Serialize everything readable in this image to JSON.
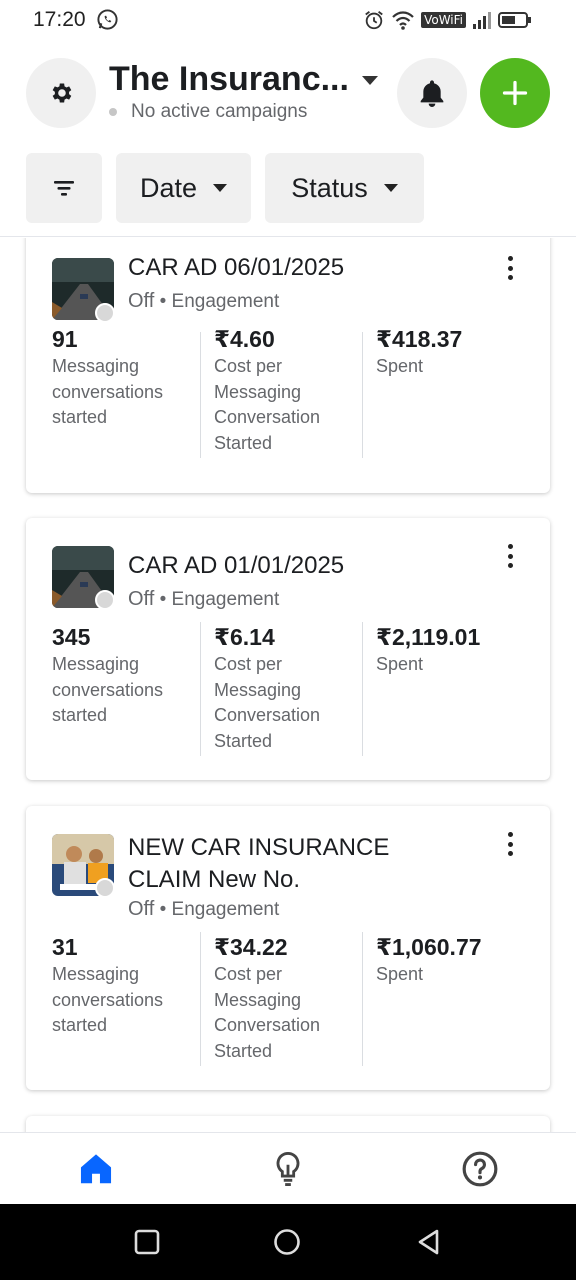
{
  "status_bar": {
    "time": "17:20",
    "vowifi_label": "VoWiFi"
  },
  "header": {
    "account_name": "The Insuranc...",
    "campaign_status": "No active campaigns"
  },
  "filters": {
    "date_label": "Date",
    "status_label": "Status"
  },
  "campaigns": [
    {
      "name": "CAR AD 06/01/2025",
      "state": "Off",
      "objective": "Engagement",
      "metrics": [
        {
          "value": "91",
          "label": "Messaging conversations started"
        },
        {
          "value": "₹4.60",
          "label": "Cost per Messaging Conversation Started"
        },
        {
          "value": "₹418.37",
          "label": "Spent"
        }
      ]
    },
    {
      "name": "CAR AD 01/01/2025",
      "state": "Off",
      "objective": "Engagement",
      "metrics": [
        {
          "value": "345",
          "label": "Messaging conversations started"
        },
        {
          "value": "₹6.14",
          "label": "Cost per Messaging Conversation Started"
        },
        {
          "value": "₹2,119.01",
          "label": "Spent"
        }
      ]
    },
    {
      "name": "NEW CAR INSURANCE CLAIM New No.",
      "state": "Off",
      "objective": "Engagement",
      "metrics": [
        {
          "value": "31",
          "label": "Messaging conversations started"
        },
        {
          "value": "₹34.22",
          "label": "Cost per Messaging Conversation Started"
        },
        {
          "value": "₹1,060.77",
          "label": "Spent"
        }
      ]
    }
  ],
  "colors": {
    "accent_green": "#53b81f",
    "nav_active_blue": "#0866ff"
  },
  "icons": [
    "whatsapp-icon",
    "alarm-icon",
    "wifi-icon",
    "signal-icon",
    "battery-icon",
    "gear-icon",
    "bell-icon",
    "plus-icon",
    "filter-icon",
    "more-icon",
    "home-icon",
    "lightbulb-icon",
    "help-icon",
    "square-icon",
    "circle-icon",
    "back-triangle-icon"
  ]
}
